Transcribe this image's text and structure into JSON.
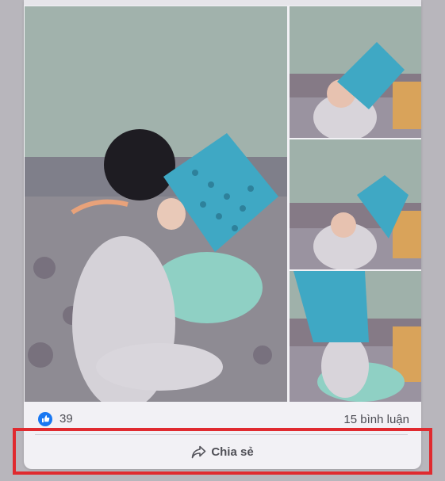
{
  "post": {
    "photos": [
      {
        "name": "main-photo"
      },
      {
        "name": "thumb-1"
      },
      {
        "name": "thumb-2"
      },
      {
        "name": "thumb-3"
      }
    ],
    "reactions": {
      "like_icon": "thumbs-up-icon",
      "like_count": "39",
      "comments": "15 bình luận"
    },
    "actions": {
      "share_icon": "share-arrow-icon",
      "share_label": "Chia sẻ"
    }
  },
  "colors": {
    "highlight": "#e02a2f",
    "like_blue": "#1877f2",
    "basket_blue": "#3fa8c4"
  }
}
